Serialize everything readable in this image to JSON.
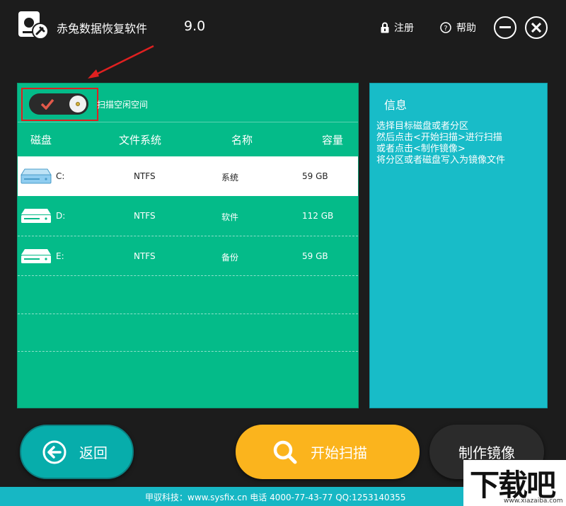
{
  "app": {
    "title": "赤兔数据恢复软件",
    "version": "9.0"
  },
  "titlebar": {
    "register_label": "注册",
    "help_label": "帮助",
    "lock_icon": "lock-icon",
    "help_icon": "question-circle-icon",
    "minimize_icon": "minus-circle-icon",
    "close_icon": "close-circle-icon"
  },
  "toggle": {
    "label": "扫描空闲空间",
    "checked": true
  },
  "table": {
    "headers": [
      "磁盘",
      "文件系统",
      "名称",
      "容量"
    ],
    "rows": [
      {
        "letter": "C:",
        "fs": "NTFS",
        "name": "系统",
        "size": "59 GB",
        "selected": true
      },
      {
        "letter": "D:",
        "fs": "NTFS",
        "name": "软件",
        "size": "112 GB",
        "selected": false
      },
      {
        "letter": "E:",
        "fs": "NTFS",
        "name": "备份",
        "size": "59 GB",
        "selected": false
      }
    ]
  },
  "info": {
    "title": "信息",
    "lines": [
      "选择目标磁盘或者分区",
      "然后点击<开始扫描>进行扫描",
      "或者点击<制作镜像>",
      "将分区或者磁盘写入为镜像文件"
    ]
  },
  "buttons": {
    "back": "返回",
    "scan": "开始扫描",
    "make_image": "制作镜像"
  },
  "footer": {
    "text": "甲驭科技：www.sysfix.cn 电话 4000-77-43-77 QQ:1253140355"
  },
  "watermark": {
    "main": "下载吧",
    "url": "www.xiazaiba.com"
  },
  "colors": {
    "background": "#1c1c1c",
    "disk_panel": "#04bb89",
    "info_panel": "#18bcc8",
    "scan_button": "#fbb41d",
    "back_button": "#07adab",
    "annotation": "#e02020"
  }
}
